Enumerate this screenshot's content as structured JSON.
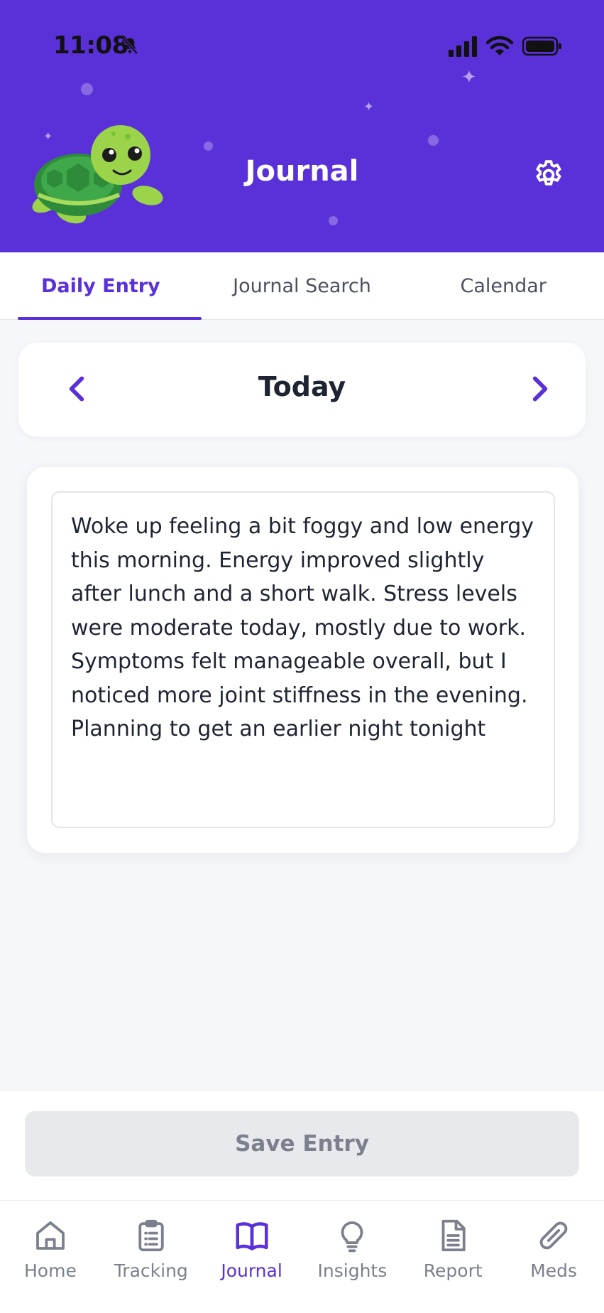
{
  "status_bar": {
    "time": "11:08"
  },
  "header": {
    "title": "Journal"
  },
  "tabs": [
    {
      "label": "Daily Entry",
      "active": true
    },
    {
      "label": "Journal Search",
      "active": false
    },
    {
      "label": "Calendar",
      "active": false
    }
  ],
  "date_nav": {
    "label": "Today"
  },
  "entry": {
    "text": "Woke up feeling a bit foggy and low energy this morning. Energy improved slightly after lunch and a short walk. Stress levels were moderate today, mostly due to work. Symptoms felt manageable overall, but I noticed more joint stiffness in the evening. Planning to get an earlier night tonight"
  },
  "save": {
    "label": "Save Entry"
  },
  "bottom_nav": [
    {
      "label": "Home",
      "icon": "home-icon"
    },
    {
      "label": "Tracking",
      "icon": "clipboard-icon"
    },
    {
      "label": "Journal",
      "icon": "book-icon",
      "active": true
    },
    {
      "label": "Insights",
      "icon": "lightbulb-icon"
    },
    {
      "label": "Report",
      "icon": "document-icon"
    },
    {
      "label": "Meds",
      "icon": "pill-icon"
    }
  ],
  "colors": {
    "accent": "#5a30d9",
    "header_bg": "#5a30d9",
    "text": "#1f2433",
    "muted": "#7b808c"
  }
}
